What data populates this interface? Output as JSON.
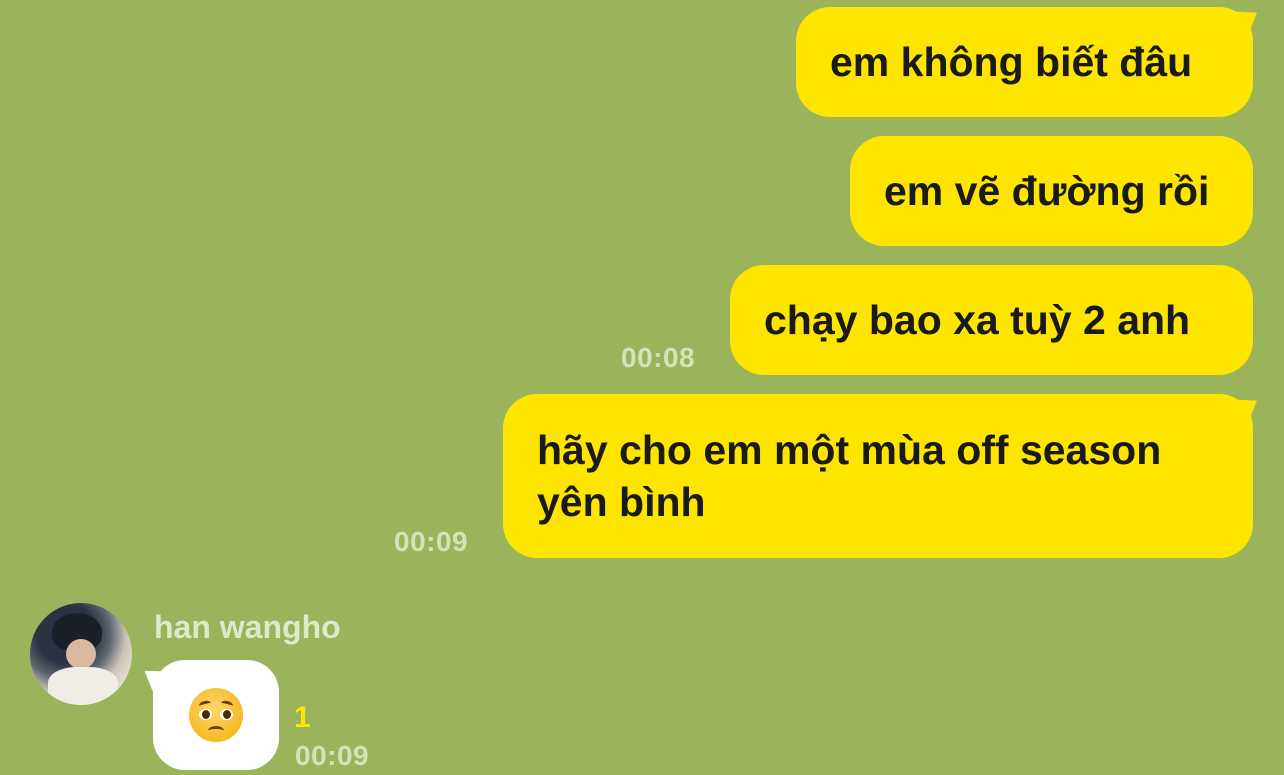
{
  "colors": {
    "background": "#9bb35a",
    "outgoing_bubble": "#fee500",
    "incoming_bubble": "#ffffff",
    "timestamp": "#d7e2b8",
    "unread_count": "#fee500"
  },
  "outgoing_messages": [
    {
      "text": "em không biết đâu"
    },
    {
      "text": "em vẽ đường rồi"
    },
    {
      "text": "chạy bao xa tuỳ 2 anh",
      "time": "00:08"
    },
    {
      "text": "hãy cho em một mùa off season yên bình",
      "time": "00:09"
    }
  ],
  "incoming_message": {
    "sender": "han wangho",
    "avatar_icon": "profile-photo",
    "emoji_icon": "pleading-face-emoji",
    "unread": "1",
    "time": "00:09"
  }
}
